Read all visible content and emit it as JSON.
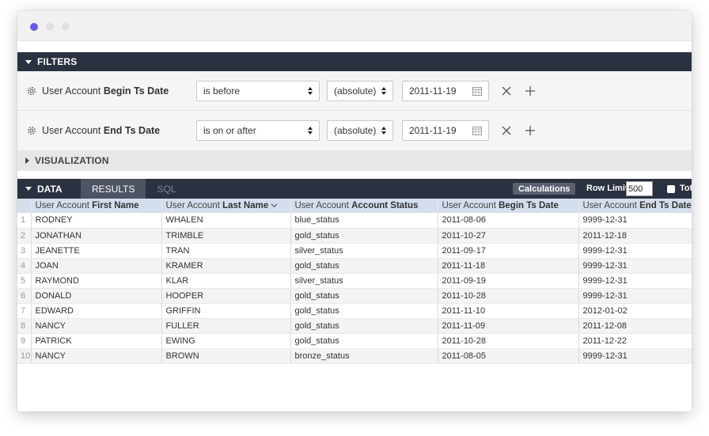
{
  "filters": {
    "header": "FILTERS",
    "rows": [
      {
        "label_prefix": "User Account ",
        "label_field": "Begin Ts Date",
        "operator": "is before",
        "mode": "(absolute)",
        "date": "2011-11-19"
      },
      {
        "label_prefix": "User Account ",
        "label_field": "End Ts Date",
        "operator": "is on or after",
        "mode": "(absolute)",
        "date": "2011-11-19"
      }
    ]
  },
  "visualization": {
    "header": "VISUALIZATION"
  },
  "data": {
    "header": "DATA",
    "tabs": [
      "RESULTS",
      "SQL"
    ],
    "calculations_label": "Calculations",
    "row_limit_label": "Row Limit",
    "row_limit_value": "500",
    "totals_label": "Tot"
  },
  "table": {
    "columns": [
      {
        "prefix": "User Account ",
        "field": "First Name"
      },
      {
        "prefix": "User Account ",
        "field": "Last Name"
      },
      {
        "prefix": "User Account ",
        "field": "Account Status"
      },
      {
        "prefix": "User Account ",
        "field": "Begin Ts Date"
      },
      {
        "prefix": "User Account ",
        "field": "End Ts Date"
      }
    ],
    "rows": [
      [
        "1",
        "RODNEY",
        "WHALEN",
        "blue_status",
        "2011-08-06",
        "9999-12-31"
      ],
      [
        "2",
        "JONATHAN",
        "TRIMBLE",
        "gold_status",
        "2011-10-27",
        "2011-12-18"
      ],
      [
        "3",
        "JEANETTE",
        "TRAN",
        "silver_status",
        "2011-09-17",
        "9999-12-31"
      ],
      [
        "4",
        "JOAN",
        "KRAMER",
        "gold_status",
        "2011-11-18",
        "9999-12-31"
      ],
      [
        "5",
        "RAYMOND",
        "KLAR",
        "silver_status",
        "2011-09-19",
        "9999-12-31"
      ],
      [
        "6",
        "DONALD",
        "HOOPER",
        "gold_status",
        "2011-10-28",
        "9999-12-31"
      ],
      [
        "7",
        "EDWARD",
        "GRIFFIN",
        "gold_status",
        "2011-11-10",
        "2012-01-02"
      ],
      [
        "8",
        "NANCY",
        "FULLER",
        "gold_status",
        "2011-11-09",
        "2011-12-08"
      ],
      [
        "9",
        "PATRICK",
        "EWING",
        "gold_status",
        "2011-10-28",
        "2011-12-22"
      ],
      [
        "10",
        "NANCY",
        "BROWN",
        "bronze_status",
        "2011-08-05",
        "9999-12-31"
      ]
    ]
  },
  "colors": {
    "header_dark": "#2a3140",
    "accent_dot": "#6a5ae8",
    "table_header": "#d4deed"
  }
}
